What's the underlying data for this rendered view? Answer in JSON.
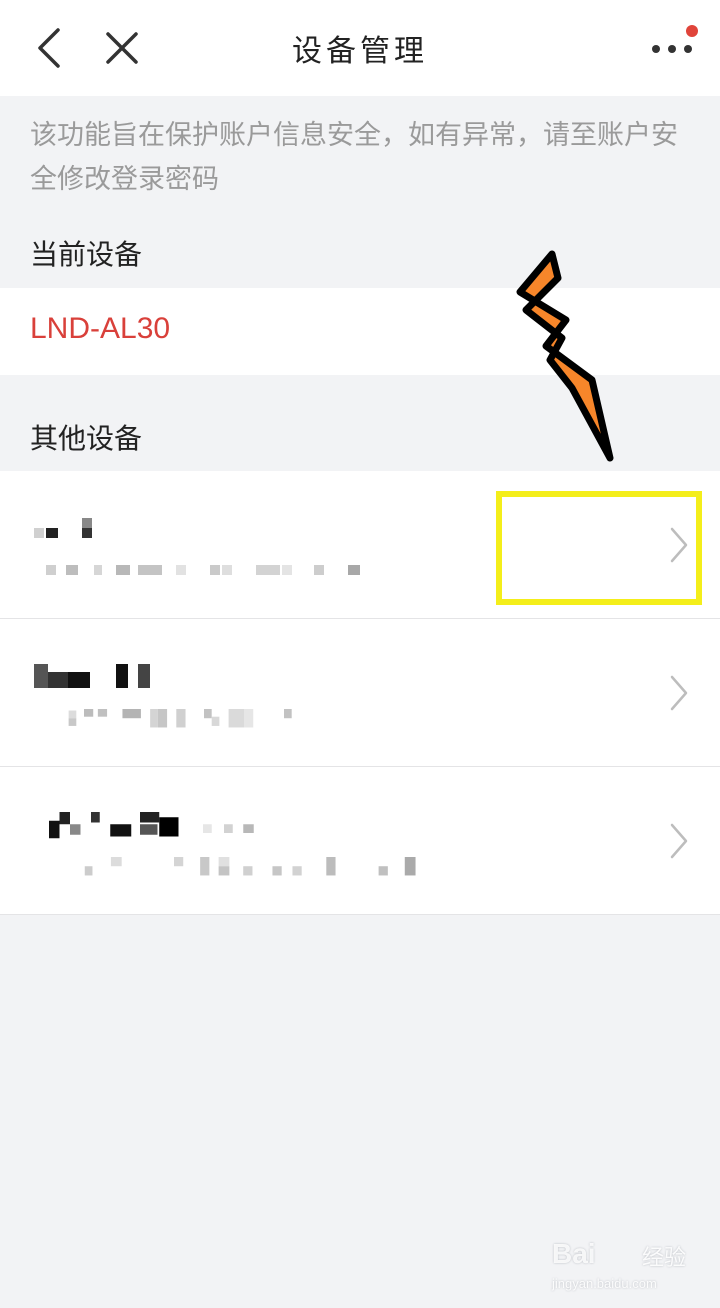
{
  "header": {
    "title": "设备管理"
  },
  "notice": "该功能旨在保护账户信息安全，如有异常，请至账户安全修改登录密码",
  "current_section": {
    "title": "当前设备",
    "device_name": "LND-AL30"
  },
  "other_section": {
    "title": "其他设备",
    "devices": [
      {
        "name_obscured": true,
        "detail_obscured": true
      },
      {
        "name_obscured": true,
        "detail_obscured": true
      },
      {
        "name_obscured": true,
        "detail_obscured": true
      }
    ]
  },
  "annotation": {
    "highlight_color": "#f4ee1a",
    "arrow_color": "#f7862a"
  },
  "watermark": {
    "brand": "Bai",
    "brand_cn": "经验",
    "url": "jingyan.baidu.com"
  }
}
